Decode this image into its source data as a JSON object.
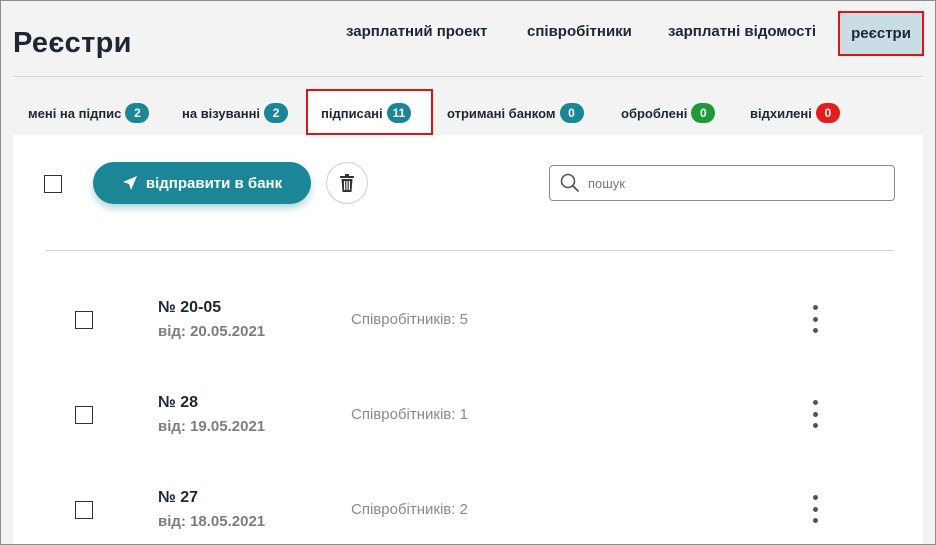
{
  "page": {
    "title": "Реєстри"
  },
  "topnav": [
    {
      "label": "зарплатний проект"
    },
    {
      "label": "співробітники"
    },
    {
      "label": "зарплатні відомості"
    },
    {
      "label": "реєстри",
      "active": true
    }
  ],
  "tabs": [
    {
      "label": "мені на підпис",
      "count": "2",
      "color": "#1a8696"
    },
    {
      "label": "на візуванні",
      "count": "2",
      "color": "#1a8696"
    },
    {
      "label": "підписані",
      "count": "11",
      "color": "#1a8696",
      "active": true
    },
    {
      "label": "отримані банком",
      "count": "0",
      "color": "#1a8696"
    },
    {
      "label": "оброблені",
      "count": "0",
      "color": "#1e9a3a"
    },
    {
      "label": "відхилені",
      "count": "0",
      "color": "#e31d1d"
    }
  ],
  "toolbar": {
    "send_label": "відправити в банк",
    "send_icon": "paper-plane-icon",
    "delete_icon": "trash-icon",
    "search_placeholder": "пошук",
    "search_icon": "search-icon"
  },
  "rows": [
    {
      "number": "№ 20-05",
      "date": "від: 20.05.2021",
      "employees": "Співробітників: 5"
    },
    {
      "number": "№ 28",
      "date": "від: 19.05.2021",
      "employees": "Співробітників: 1"
    },
    {
      "number": "№ 27",
      "date": "від: 18.05.2021",
      "employees": "Співробітників: 2"
    }
  ],
  "colors": {
    "accent": "#1a8696",
    "highlight": "#e11212",
    "active_nav_bg": "#c9dde5"
  }
}
